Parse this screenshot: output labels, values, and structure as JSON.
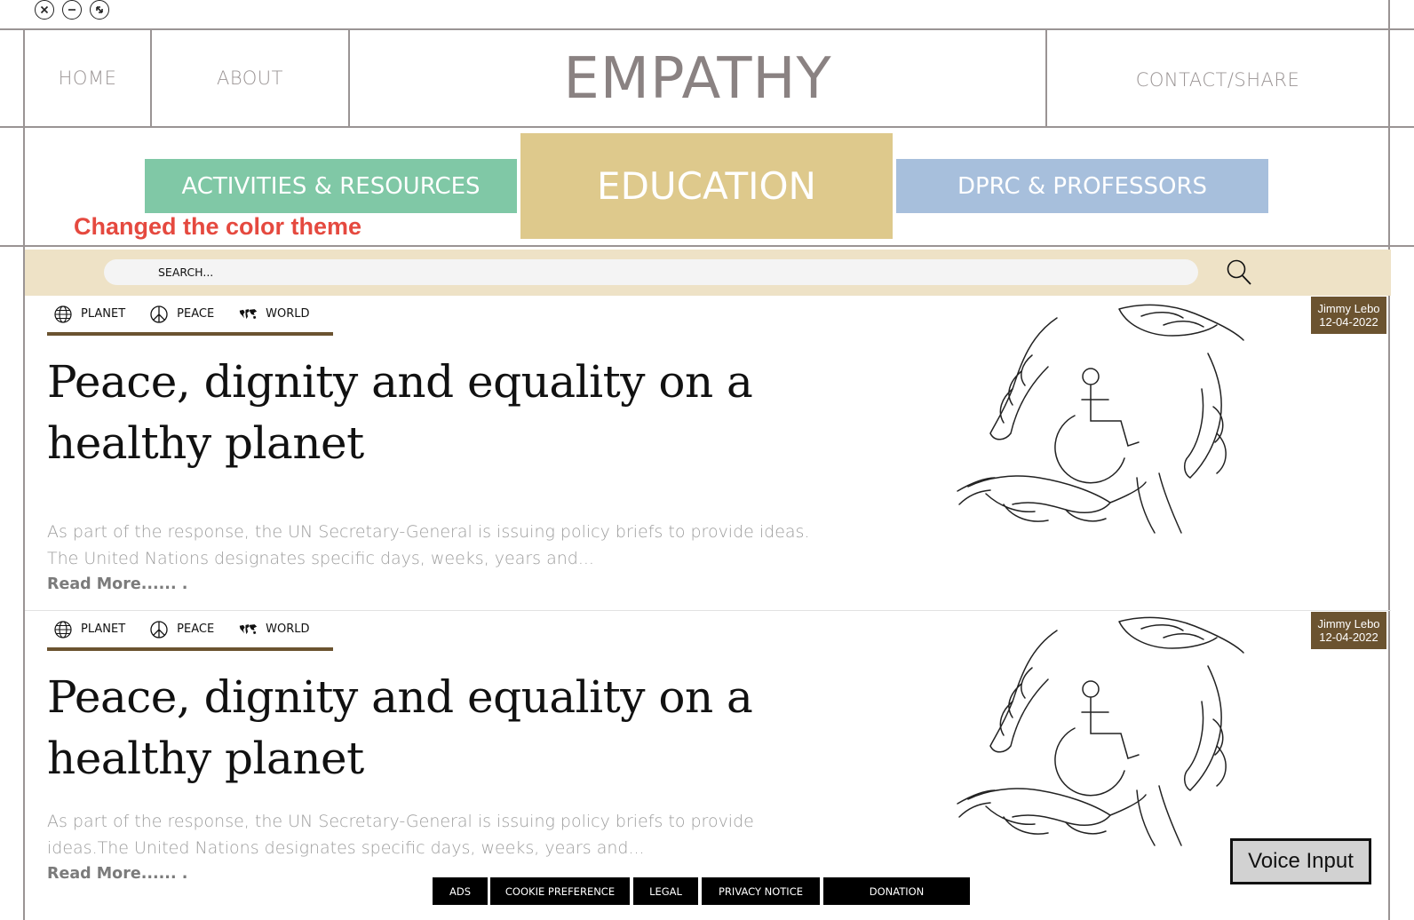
{
  "nav": {
    "home": "HOME",
    "about": "ABOUT",
    "brand": "EMPATHY",
    "contact": "CONTACT/SHARE"
  },
  "categories": {
    "activities": "ACTIVITIES & RESOURCES",
    "education": "EDUCATION",
    "dprc": "DPRC & PROFESSORS",
    "colors": {
      "activities": "#80c8a6",
      "education": "#dec98c",
      "dprc": "#a7bfdc"
    }
  },
  "note": "Changed the color theme",
  "search": {
    "placeholder": "SEARCH..."
  },
  "articles": [
    {
      "tags": [
        "PLANET",
        "PEACE",
        "WORLD"
      ],
      "title": "Peace, dignity and equality on a healthy planet",
      "excerpt": "As part of the response, the UN Secretary-General is issuing policy briefs to provide ideas. The United Nations designates specific days, weeks, years and...",
      "read_more": "Read More...... .",
      "author": "Jimmy Lebo",
      "date": "12-04-2022"
    },
    {
      "tags": [
        "PLANET",
        "PEACE",
        "WORLD"
      ],
      "title": "Peace, dignity and equality on a healthy planet",
      "excerpt": "As part of the response, the UN Secretary-General is issuing policy briefs to provide ideas.The United Nations designates specific days, weeks, years and...",
      "read_more": "Read More...... .",
      "author": "Jimmy Lebo",
      "date": "12-04-2022"
    }
  ],
  "footer": {
    "ads": "ADS",
    "cookie": "COOKIE PREFERENCE",
    "legal": "LEGAL",
    "privacy": "PRIVACY NOTICE",
    "donation": "DONATION"
  },
  "voice_input": "Voice Input",
  "icons": {
    "window": [
      "close-icon",
      "minimize-icon",
      "maximize-icon"
    ],
    "tags": [
      "globe-icon",
      "peace-icon",
      "world-map-icon"
    ],
    "search": "search-icon"
  },
  "accent": "#6b5330"
}
